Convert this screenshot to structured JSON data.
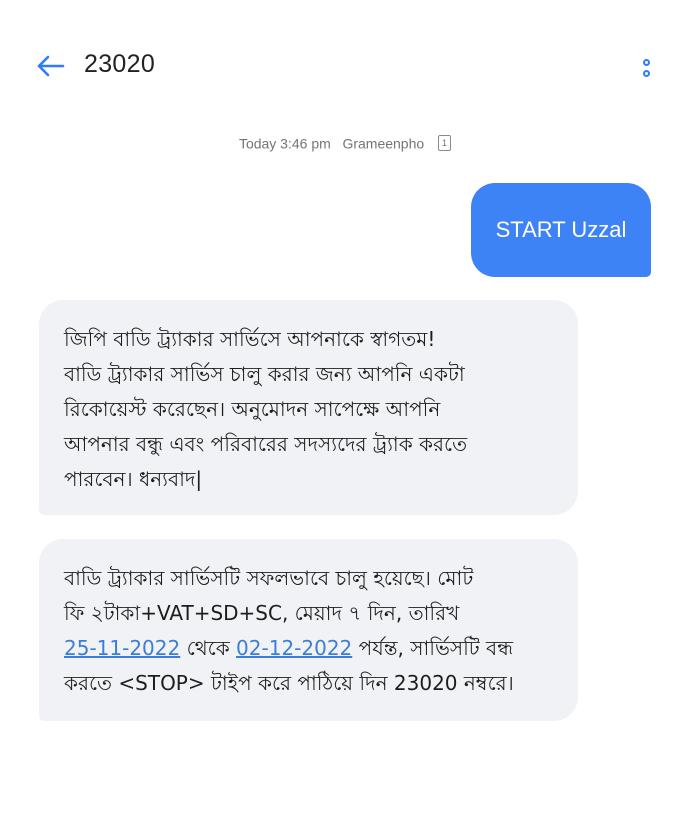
{
  "header": {
    "title": "23020",
    "back_icon": "arrow-left-icon",
    "more_icon": "more-vertical-icon",
    "accent_color": "#2f7cf6"
  },
  "meta": {
    "time": "Today 3:46 pm",
    "carrier": "Grameenpho",
    "sim": "1"
  },
  "sent_message": {
    "text": "START Uzzal",
    "color": "#3d83f5"
  },
  "received_messages": [
    {
      "lines": [
        "জিপি বাডি ট্র্যাকার সার্ভিসে আপনাকে স্বাগতম!",
        "বাডি ট্র্যাকার সার্ভিস চালু করার জন্য আপনি একটা",
        "রিকোয়েস্ট করেছেন। অনুমোদন সাপেক্ষে আপনি",
        "আপনার বন্ধু এবং পরিবারের সদস্যদের ট্র্যাক করতে",
        "পারবেন। ধন্যবাদ|"
      ]
    },
    {
      "line1": "বাডি ট্র্যাকার সার্ভিসটি সফলভাবে চালু হয়েছে। মোট",
      "line2": "ফি ২টাকা+VAT+SD+SC, মেয়াদ ৭ দিন, তারিখ",
      "date_from": "25-11-2022",
      "between": " থেকে ",
      "date_to": "02-12-2022",
      "line3_tail": " পর্যন্ত, সার্ভিসটি বন্ধ",
      "line4": "করতে <STOP> টাইপ করে পাঠিয়ে দিন 23020 নম্বরে।"
    }
  ]
}
